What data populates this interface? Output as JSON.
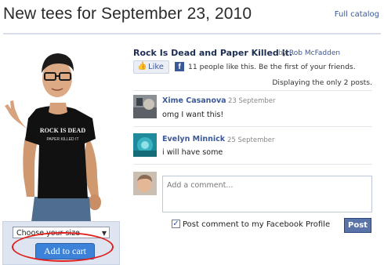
{
  "header": {
    "title": "New tees for September 23, 2010",
    "full_catalog_link": "Full catalog"
  },
  "product": {
    "shirt_print_line1": "ROCK IS DEAD",
    "shirt_print_line2": "PAPER KILLED IT",
    "size_select": {
      "selected": "Choose your size"
    },
    "add_to_cart_label": "Add to cart"
  },
  "post": {
    "title": "Rock Is Dead and Paper Killed It.",
    "by_prefix": "by",
    "author": "Rob McFadden"
  },
  "like_bar": {
    "like_label": "Like",
    "fb_glyph": "f",
    "like_text": "11 people like this. Be the first of your friends."
  },
  "displaying_text": "Displaying the only 2 posts.",
  "comments": [
    {
      "name": "Xime Casanova",
      "date": "23 September",
      "text": "omg I want this!"
    },
    {
      "name": "Evelyn Minnick",
      "date": "25 September",
      "text": "i will have some"
    }
  ],
  "comment_form": {
    "placeholder": "Add a comment...",
    "checkbox_checked": true,
    "checkbox_label": "Post comment to my Facebook Profile",
    "post_button_label": "Post"
  },
  "colors": {
    "facebook_blue": "#3b5998",
    "cart_button": "#3b82d8",
    "highlight_oval": "#e0201e"
  }
}
